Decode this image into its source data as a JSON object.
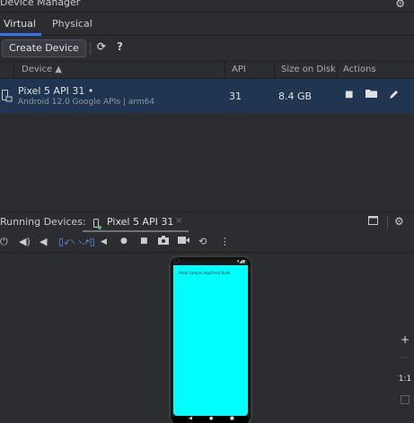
{
  "window": {
    "title": "Device Manager"
  },
  "tabs": [
    {
      "label": "Virtual",
      "active": true
    },
    {
      "label": "Physical",
      "active": false
    }
  ],
  "toolbar": {
    "create_label": "Create Device",
    "help_label": "?"
  },
  "table": {
    "columns": {
      "device": "Device ▲",
      "api": "API",
      "size": "Size on Disk",
      "actions": "Actions"
    },
    "rows": [
      {
        "name": "Pixel 5 API 31",
        "running_dot": "•",
        "subtitle": "Android 12.0 Google APIs | arm64",
        "api": "31",
        "size": "8.4 GB"
      }
    ]
  },
  "running_devices": {
    "label": "Running Devices:",
    "tab_label": "Pixel 5 API 31",
    "close_glyph": "×"
  },
  "emulator": {
    "app_text": "Hello Sample AppFresh Build",
    "zoom": {
      "in": "+",
      "out": "—",
      "actual": "1:1"
    }
  },
  "colors": {
    "accent": "#3574f0",
    "selection": "#20354f",
    "screen": "#00ffff"
  }
}
